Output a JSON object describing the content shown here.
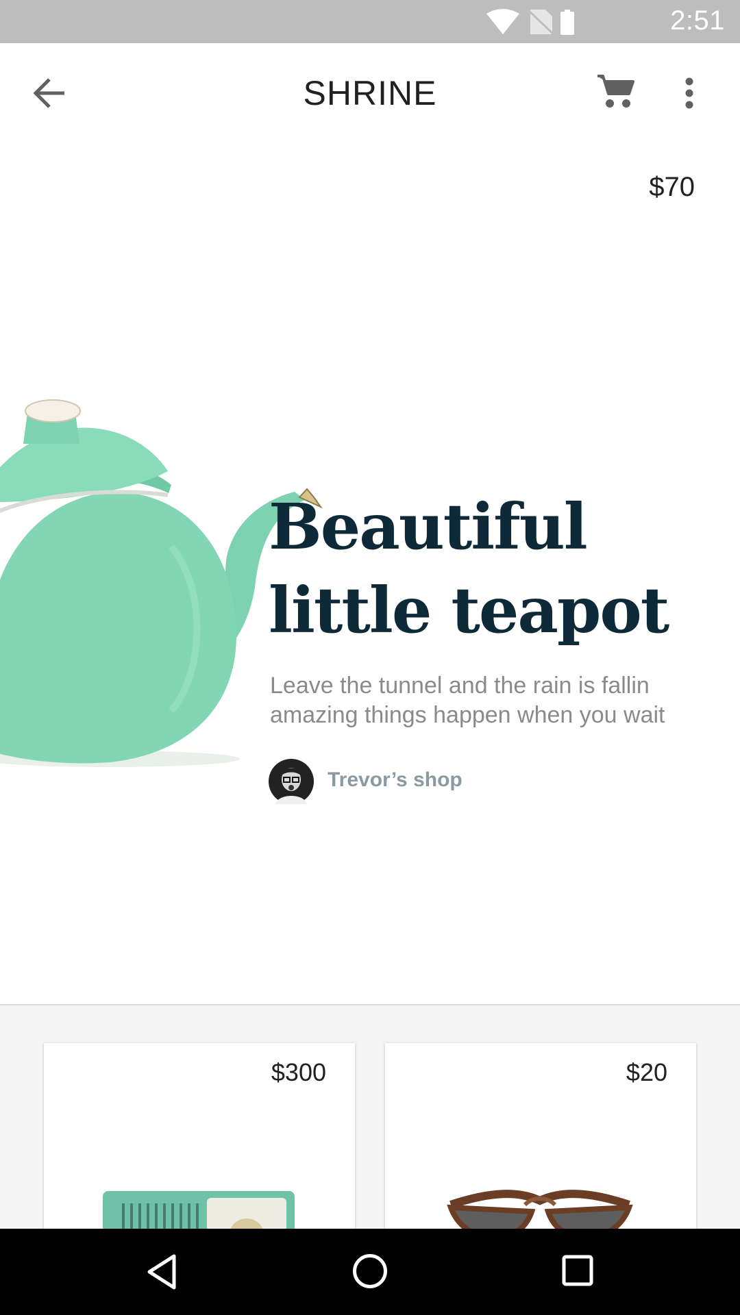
{
  "status_bar": {
    "time": "2:51",
    "icons": [
      "wifi-icon",
      "no-sim-icon",
      "battery-icon"
    ]
  },
  "app_bar": {
    "title": "SHRINE",
    "icons": [
      "back-arrow-icon",
      "cart-icon",
      "more-vert-icon"
    ]
  },
  "featured": {
    "price": "$70",
    "title": "Beautiful little teapot",
    "description": "Leave the tunnel and the rain is fallin amazing things happen when you wait",
    "vendor": "Trevor’s shop"
  },
  "products": [
    {
      "price": "$300",
      "image": "radio"
    },
    {
      "price": "$20",
      "image": "sunglasses"
    }
  ],
  "nav_bar": {
    "icons": [
      "back-triangle-icon",
      "home-circle-icon",
      "recents-square-icon"
    ]
  },
  "colors": {
    "title_color": "#0e2a38",
    "teapot": "#7dd3b1",
    "vendor_text": "#8a9aa3"
  }
}
